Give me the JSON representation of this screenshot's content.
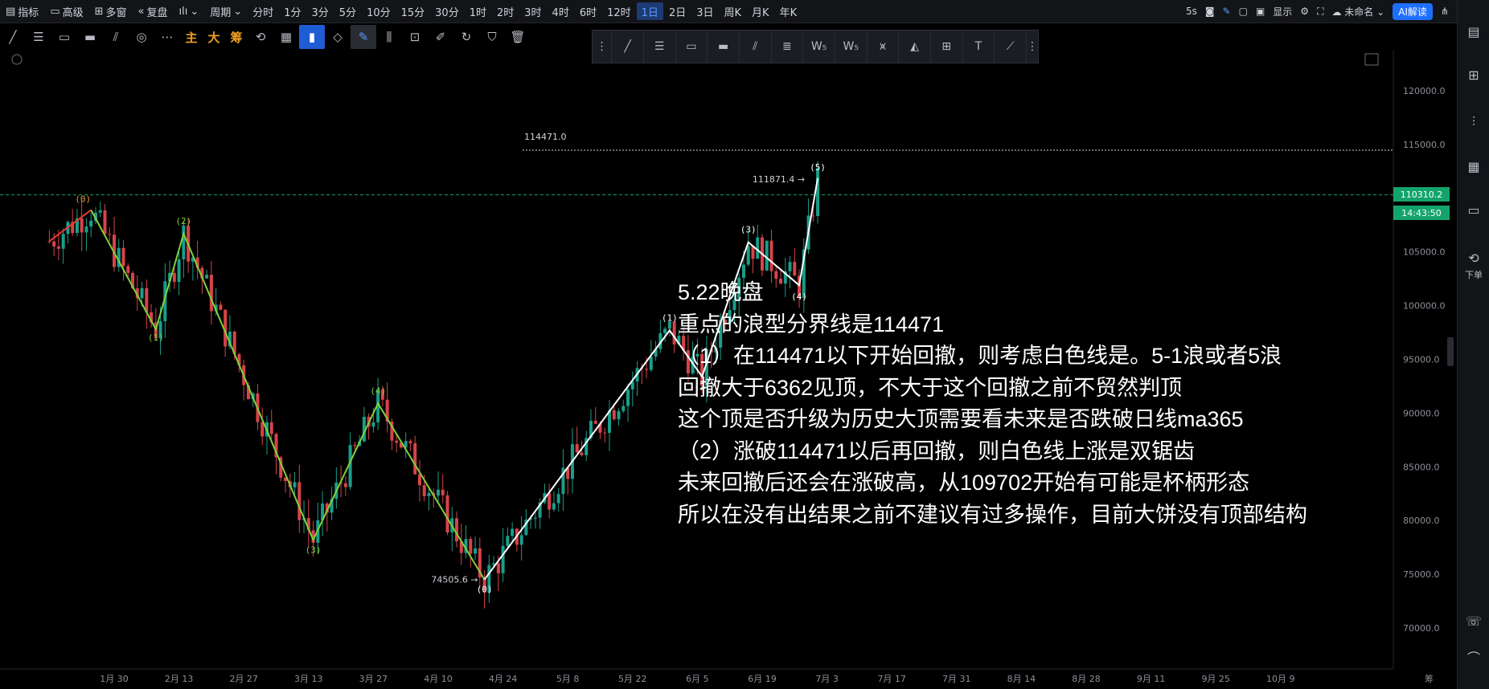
{
  "topbar": {
    "items": [
      {
        "label": "指标",
        "icon": "indicator-icon"
      },
      {
        "label": "高级",
        "icon": "advanced-icon"
      },
      {
        "label": "多窗",
        "icon": "multiwindow-icon"
      },
      {
        "label": "复盘",
        "icon": "replay-icon"
      },
      {
        "label": "",
        "icon": "chart-type-icon"
      },
      {
        "label": "周期",
        "icon": "period-icon"
      }
    ],
    "timeframes": [
      "分时",
      "1分",
      "3分",
      "5分",
      "10分",
      "15分",
      "30分",
      "1时",
      "2时",
      "3时",
      "4时",
      "6时",
      "12时",
      "1日",
      "2日",
      "3日",
      "周K",
      "月K",
      "年K"
    ],
    "active_timeframe": "1日",
    "right": {
      "interval": "5s",
      "display": "显示",
      "layout_name": "未命名",
      "ai_button": "AI解读"
    }
  },
  "drawing_toolbar": {
    "text_tools": [
      "主",
      "大",
      "筹"
    ]
  },
  "right_panel": {
    "order_label": "下单"
  },
  "chart": {
    "y_ticks": [
      "120000.0",
      "115000.0",
      "110000.0",
      "105000.0",
      "100000.0",
      "95000.0",
      "90000.0",
      "85000.0",
      "80000.0",
      "75000.0",
      "70000.0"
    ],
    "x_ticks": [
      "1月 30",
      "2月 13",
      "2月 27",
      "3月 13",
      "3月 27",
      "4月 10",
      "4月 24",
      "5月 8",
      "5月 22",
      "6月 5",
      "6月 19",
      "7月 3",
      "7月 17",
      "7月 31",
      "8月 14",
      "8月 28",
      "9月 11",
      "9月 25",
      "10月 9"
    ],
    "x_tail": "筹",
    "current_price": "110310.2",
    "countdown": "14:43:50",
    "level_line": "114471.0",
    "high_label": "111871.4",
    "low_label": "74505.6",
    "wave_labels": {
      "green": [
        "(0)",
        "(1)",
        "(2)",
        "(3)",
        "(4)"
      ],
      "white": [
        "(0)",
        "(1)",
        "(2)",
        "(3)",
        "(4)",
        "(5)"
      ]
    },
    "colors": {
      "bull": "#1a9e8a",
      "bear": "#d8434a",
      "green_wave": "#7fd13b",
      "white_wave": "#ffffff",
      "red_line": "#e53935",
      "accent": "#14a46b"
    }
  },
  "annotation": [
    "5.22晚盘",
    "重点的浪型分界线是114471",
    "（1）在114471以下开始回撤，则考虑白色线是。5-1浪或者5浪",
    "回撤大于6362见顶，不大于这个回撤之前不贸然判顶",
    "这个顶是否升级为历史大顶需要看未来是否跌破日线ma365",
    "（2）涨破114471以后再回撤，则白色线上涨是双锯齿",
    "未来回撤后还会在涨破高，从109702开始有可能是杯柄形态",
    "所以在没有出结果之前不建议有过多操作，目前大饼没有顶部结构"
  ]
}
